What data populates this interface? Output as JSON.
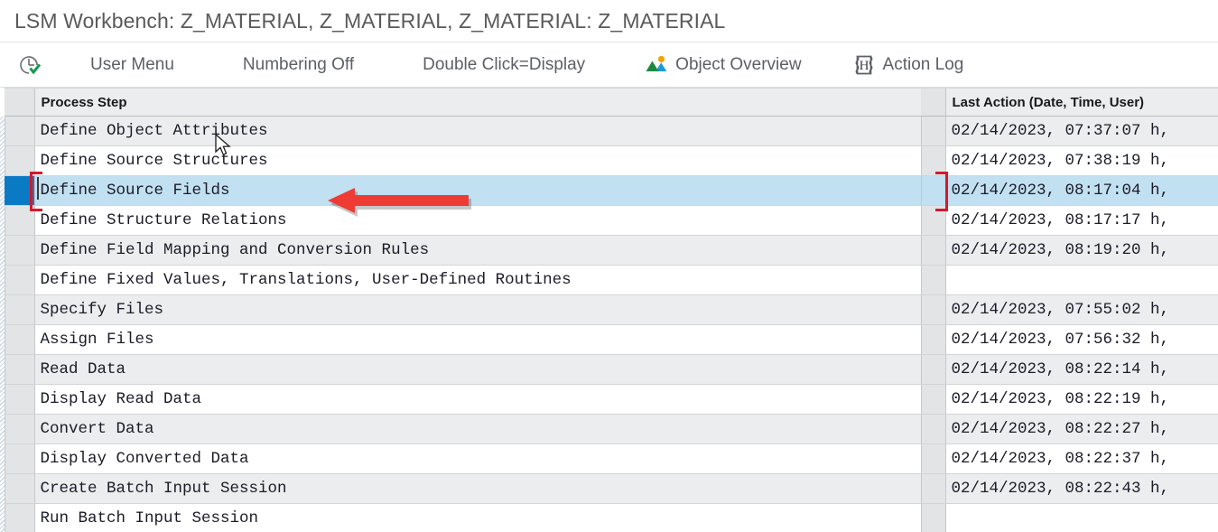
{
  "window": {
    "title": "LSM Workbench: Z_MATERIAL, Z_MATERIAL, Z_MATERIAL: Z_MATERIAL"
  },
  "toolbar": {
    "items": [
      {
        "name": "history-check-icon",
        "icon": "clock-check-icon",
        "label": ""
      },
      {
        "name": "user-menu",
        "icon": "",
        "label": "User Menu"
      },
      {
        "name": "numbering-off",
        "icon": "",
        "label": "Numbering Off"
      },
      {
        "name": "double-click-display",
        "icon": "",
        "label": "Double Click=Display"
      },
      {
        "name": "object-overview",
        "icon": "landscape-icon",
        "label": "Object Overview"
      },
      {
        "name": "action-log",
        "icon": "h-document-icon",
        "label": "Action Log"
      }
    ]
  },
  "table": {
    "headers": {
      "process_step": "Process Step",
      "last_action": "Last Action (Date, Time, User)"
    },
    "rows": [
      {
        "step": "Define Object Attributes",
        "last_action": "02/14/2023, 07:37:07 h,"
      },
      {
        "step": "Define Source Structures",
        "last_action": "02/14/2023, 07:38:19 h,"
      },
      {
        "step": "Define Source Fields",
        "last_action": "02/14/2023, 08:17:04 h,"
      },
      {
        "step": "Define Structure Relations",
        "last_action": "02/14/2023, 08:17:17 h,"
      },
      {
        "step": "Define Field Mapping and Conversion Rules",
        "last_action": "02/14/2023, 08:19:20 h,"
      },
      {
        "step": "Define Fixed Values, Translations, User-Defined Routines",
        "last_action": ""
      },
      {
        "step": "Specify Files",
        "last_action": "02/14/2023, 07:55:02 h,"
      },
      {
        "step": "Assign Files",
        "last_action": "02/14/2023, 07:56:32 h,"
      },
      {
        "step": "Read Data",
        "last_action": "02/14/2023, 08:22:14 h,"
      },
      {
        "step": "Display Read Data",
        "last_action": "02/14/2023, 08:22:19 h,"
      },
      {
        "step": "Convert Data",
        "last_action": "02/14/2023, 08:22:27 h,"
      },
      {
        "step": "Display Converted Data",
        "last_action": "02/14/2023, 08:22:37 h,"
      },
      {
        "step": "Create Batch Input Session",
        "last_action": "02/14/2023, 08:22:43 h,"
      },
      {
        "step": "Run Batch Input Session",
        "last_action": ""
      }
    ],
    "selected_row_index": 2
  },
  "annotation": {
    "arrow_color": "#ee3b33",
    "points_to": "Define Source Fields"
  },
  "colors": {
    "selection_blue": "#c1e0f2",
    "selector_block": "#0b7ac4",
    "bracket_red": "#d3192b",
    "row_alt": "#ebedee",
    "header_bg": "#ebedee"
  }
}
